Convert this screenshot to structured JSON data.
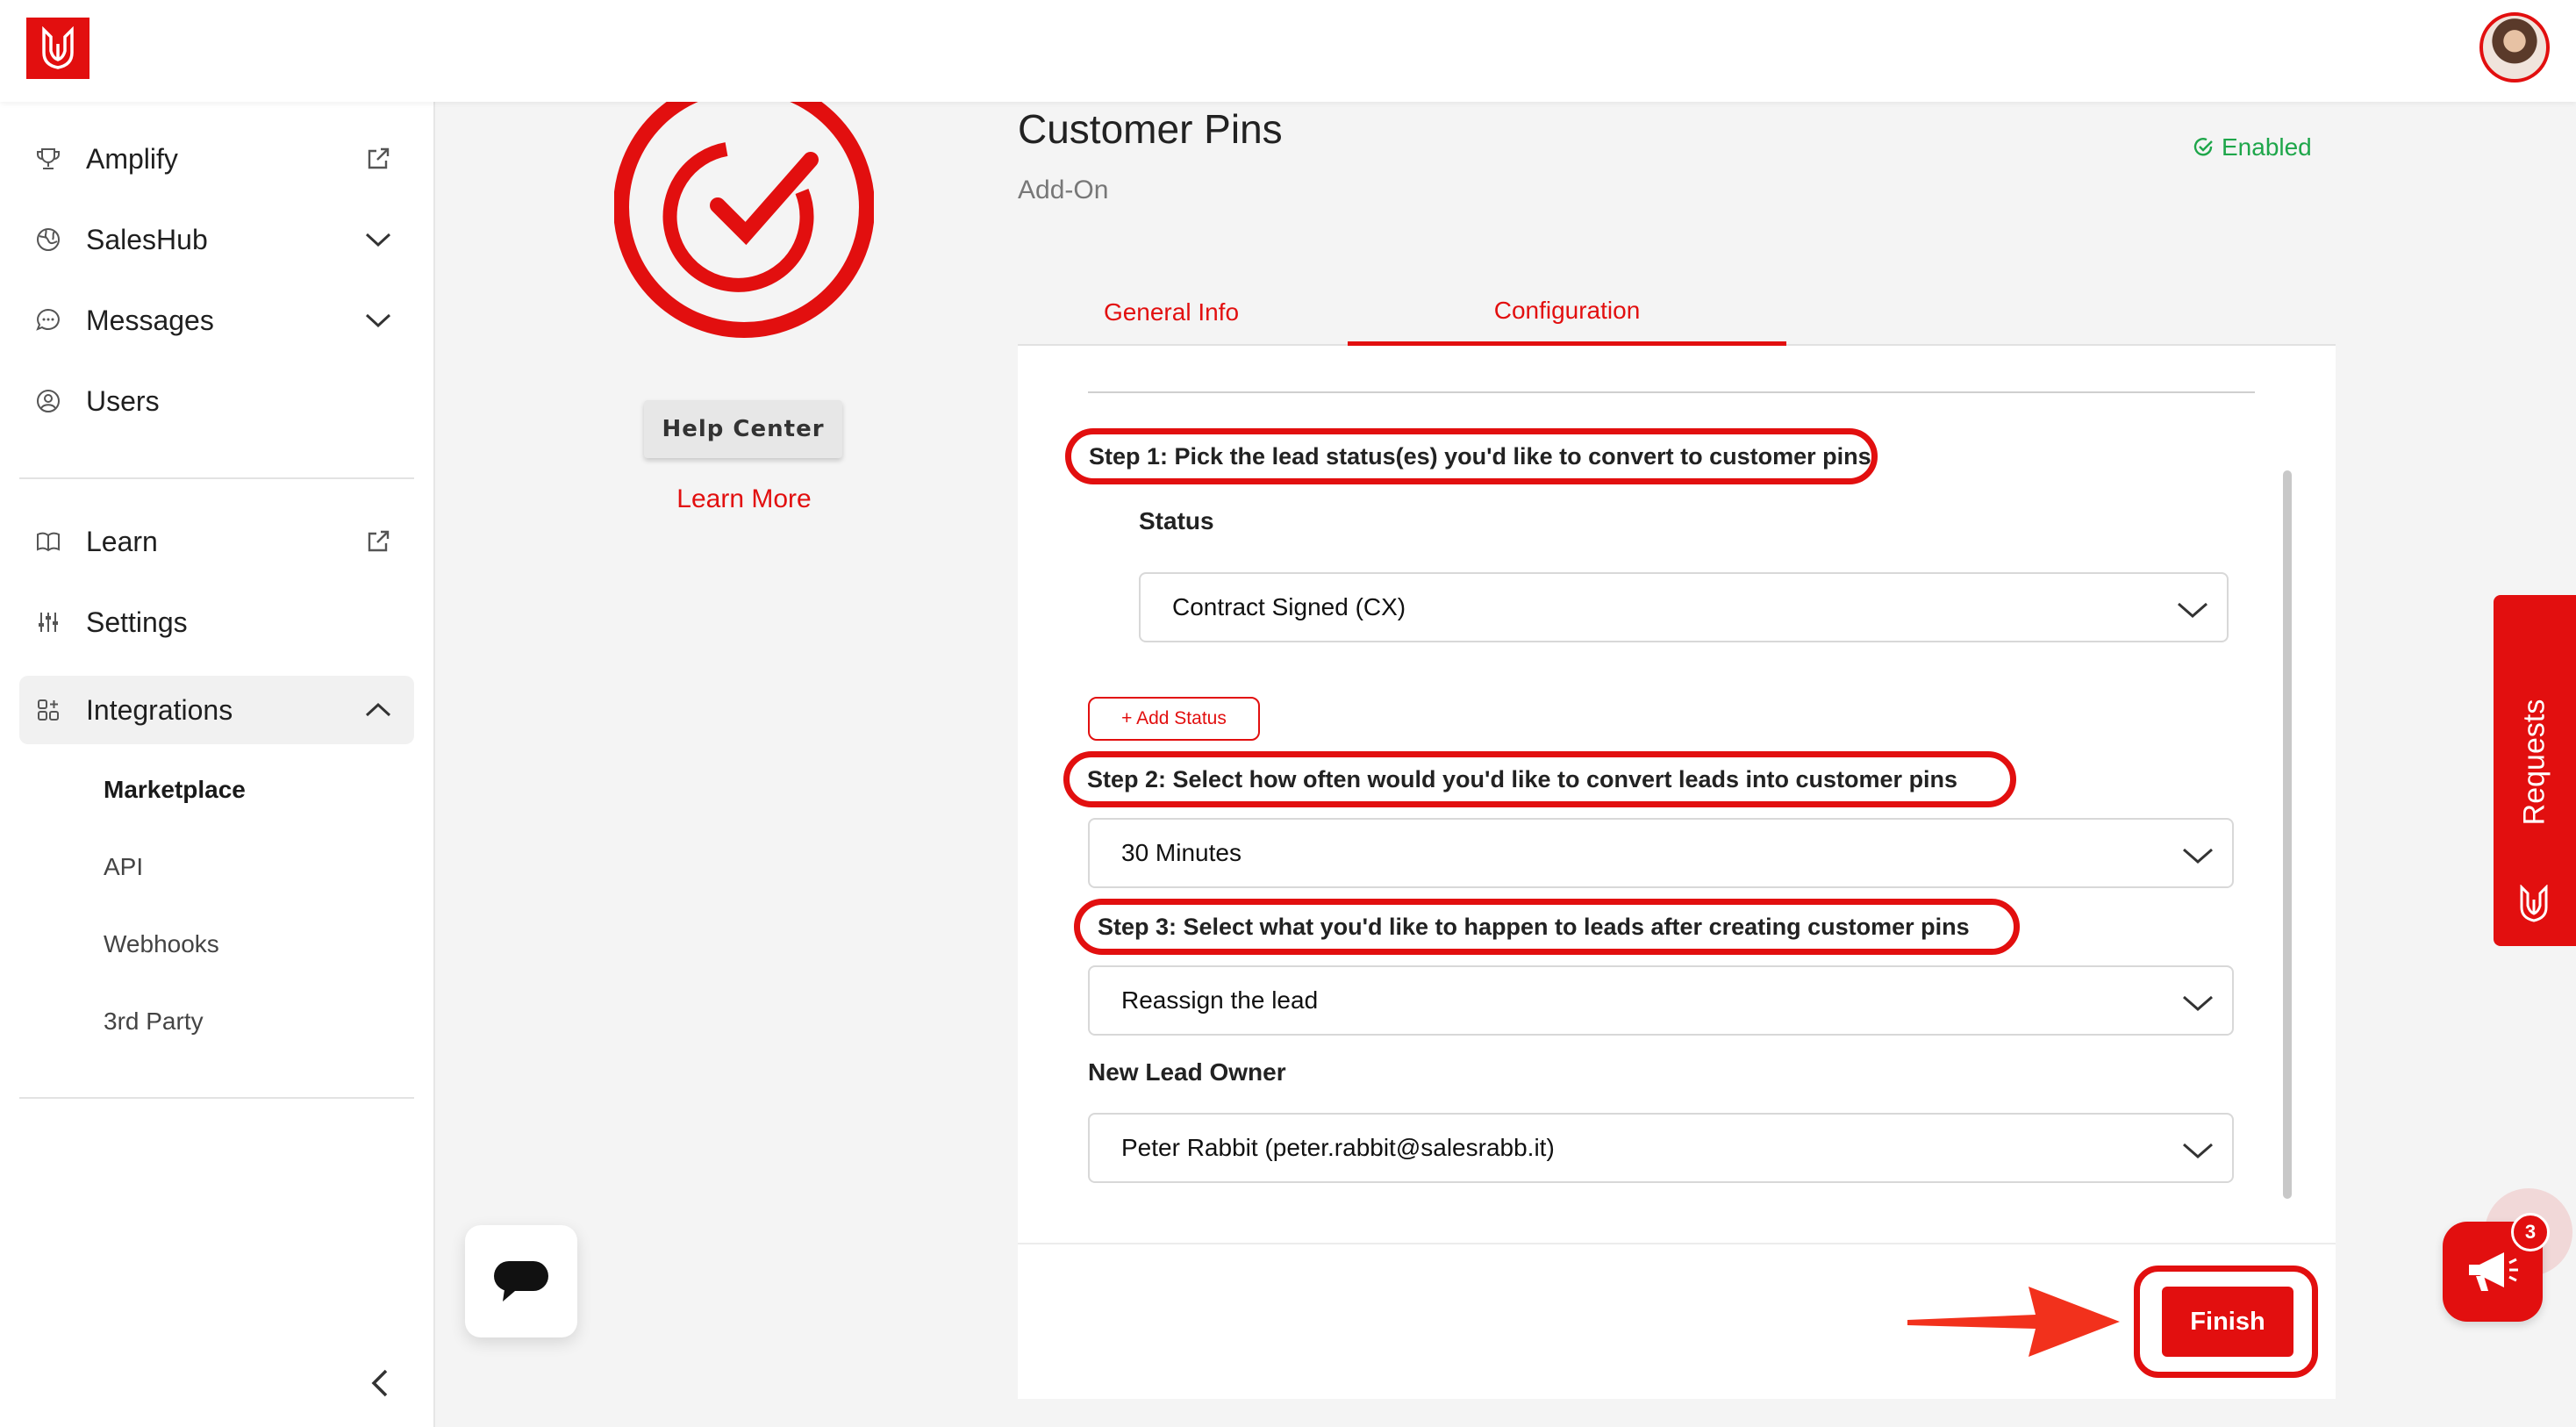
{
  "colors": {
    "brand": "#e20f0f",
    "enabled": "#1ea64a"
  },
  "sidebar": {
    "items": [
      {
        "label": "Amplify",
        "icon": "trophy-icon",
        "trail": "external-link-icon"
      },
      {
        "label": "SalesHub",
        "icon": "globe-icon",
        "trail": "chevron-down-icon"
      },
      {
        "label": "Messages",
        "icon": "chat-bubble-icon",
        "trail": "chevron-down-icon"
      },
      {
        "label": "Users",
        "icon": "user-circle-icon"
      },
      {
        "label": "Learn",
        "icon": "book-icon",
        "trail": "external-link-icon"
      },
      {
        "label": "Settings",
        "icon": "sliders-icon"
      },
      {
        "label": "Integrations",
        "icon": "grid-plus-icon",
        "trail": "chevron-up-icon"
      }
    ],
    "subitems": [
      "Marketplace",
      "API",
      "Webhooks",
      "3rd Party"
    ]
  },
  "addon": {
    "help_center": "Help Center",
    "learn_more": "Learn More"
  },
  "header": {
    "title": "Customer Pins",
    "subtitle": "Add-On",
    "status": "Enabled"
  },
  "tabs": [
    "General Info",
    "Configuration"
  ],
  "config": {
    "step1": "Step 1: Pick the lead status(es) you'd like to convert to customer pins",
    "status_label": "Status",
    "status_value": "Contract Signed (CX)",
    "add_status": "+ Add Status",
    "step2": "Step 2: Select how often would you'd like to convert leads into customer pins",
    "frequency_value": "30 Minutes",
    "step3": "Step 3: Select what you'd like to happen to leads after creating customer pins",
    "action_value": "Reassign the lead",
    "owner_label": "New Lead Owner",
    "owner_value": "Peter Rabbit (peter.rabbit@salesrabb.it)",
    "finish": "Finish"
  },
  "requests_label": "Requests",
  "announcements_count": "3"
}
